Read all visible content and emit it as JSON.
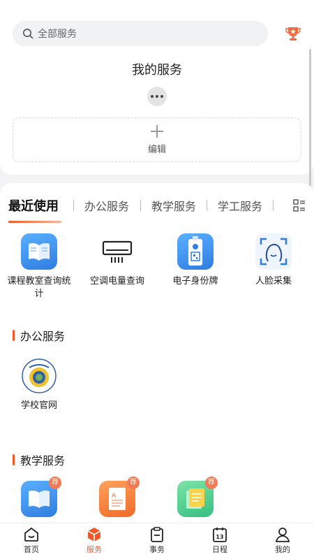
{
  "search": {
    "placeholder": "全部服务"
  },
  "my_services": {
    "title": "我的服务",
    "edit_label": "编辑"
  },
  "tabs": [
    {
      "label": "最近使用",
      "active": true
    },
    {
      "label": "办公服务"
    },
    {
      "label": "教学服务"
    },
    {
      "label": "学工服务"
    }
  ],
  "recent": [
    {
      "name": "课程教室查询统计",
      "icon": "book-icon"
    },
    {
      "name": "空调电量查询",
      "icon": "air-conditioner-icon"
    },
    {
      "name": "电子身份牌",
      "icon": "id-badge-icon"
    },
    {
      "name": "人脸采集",
      "icon": "face-scan-icon"
    }
  ],
  "office": {
    "title": "办公服务",
    "items": [
      {
        "name": "学校官网",
        "icon": "school-logo-icon"
      }
    ]
  },
  "teaching": {
    "title": "教学服务",
    "badge": "荐",
    "items": [
      {
        "icon": "book-icon"
      },
      {
        "icon": "document-icon"
      },
      {
        "icon": "notes-icon"
      }
    ]
  },
  "tabbar": [
    {
      "label": "首页",
      "icon": "home-icon"
    },
    {
      "label": "服务",
      "icon": "cube-icon",
      "active": true
    },
    {
      "label": "事务",
      "icon": "clipboard-icon"
    },
    {
      "label": "日程",
      "icon": "calendar-icon",
      "day": "13"
    },
    {
      "label": "我的",
      "icon": "user-icon"
    }
  ],
  "colors": {
    "accent": "#f05a28",
    "blue": "#2f8ae8",
    "green": "#3ec98a"
  }
}
